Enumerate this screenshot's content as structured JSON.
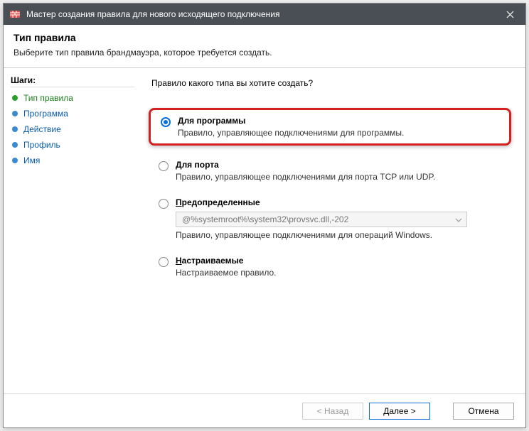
{
  "window": {
    "title": "Мастер создания правила для нового исходящего подключения"
  },
  "header": {
    "title": "Тип правила",
    "subtitle": "Выберите тип правила брандмауэра, которое требуется создать."
  },
  "steps": {
    "title": "Шаги:",
    "items": [
      {
        "label": "Тип правила",
        "active": true
      },
      {
        "label": "Программа",
        "active": false
      },
      {
        "label": "Действие",
        "active": false
      },
      {
        "label": "Профиль",
        "active": false
      },
      {
        "label": "Имя",
        "active": false
      }
    ]
  },
  "content": {
    "question": "Правило какого типа вы хотите создать?",
    "options": [
      {
        "label_pre": "Д",
        "label_rest": "ля программы",
        "desc": "Правило, управляющее подключениями для программы.",
        "selected": true,
        "highlight": true
      },
      {
        "label_pre": "Д",
        "label_rest": "ля порта",
        "desc": "Правило, управляющее подключениями для порта TCP или UDP.",
        "selected": false
      },
      {
        "label_pre": "П",
        "label_rest": "редопределенные",
        "combo": "@%systemroot%\\system32\\provsvc.dll,-202",
        "desc": "Правило, управляющее подключениями для операций Windows.",
        "selected": false
      },
      {
        "label_pre": "Н",
        "label_rest": "астраиваемые",
        "desc": "Настраиваемое правило.",
        "selected": false
      }
    ]
  },
  "footer": {
    "back": "< Назад",
    "next": "Далее >",
    "cancel": "Отмена"
  }
}
